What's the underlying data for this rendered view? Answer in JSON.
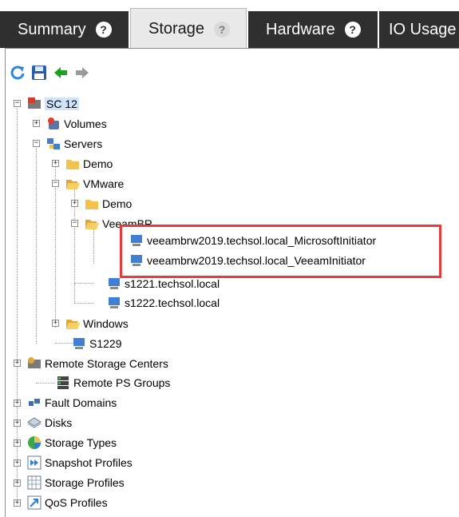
{
  "tabs": [
    {
      "label": "Summary",
      "help": "?"
    },
    {
      "label": "Storage",
      "help": "?"
    },
    {
      "label": "Hardware",
      "help": "?"
    },
    {
      "label": "IO Usage"
    }
  ],
  "toolbar": {
    "refresh_icon": "refresh-icon",
    "save_icon": "save-icon",
    "back_icon": "back-arrow-icon",
    "forward_icon": "forward-arrow-icon"
  },
  "tree": {
    "root": "SC 12",
    "volumes": "Volumes",
    "servers": "Servers",
    "demo": "Demo",
    "vmware": "VMware",
    "vmware_demo": "Demo",
    "veeambr": "VeeamBR",
    "veeam_ms": "veeambrw2019.techsol.local_MicrosoftInitiator",
    "veeam_vi": "veeambrw2019.techsol.local_VeeamInitiator",
    "s1221": "s1221.techsol.local",
    "s1222": "s1222.techsol.local",
    "windows": "Windows",
    "s1229": "S1229",
    "remote_storage_centers": "Remote Storage Centers",
    "remote_ps_groups": "Remote PS Groups",
    "fault_domains": "Fault Domains",
    "disks": "Disks",
    "storage_types": "Storage Types",
    "snapshot_profiles": "Snapshot Profiles",
    "storage_profiles": "Storage Profiles",
    "qos_profiles": "QoS Profiles"
  },
  "colors": {
    "tab_dark": "#2f2f2f",
    "tab_active": "#e9e9e9",
    "selection": "#cfe3fb",
    "highlight_border": "#e53b3b",
    "folder": "#f2c14e",
    "server": "#3f7fd6"
  }
}
